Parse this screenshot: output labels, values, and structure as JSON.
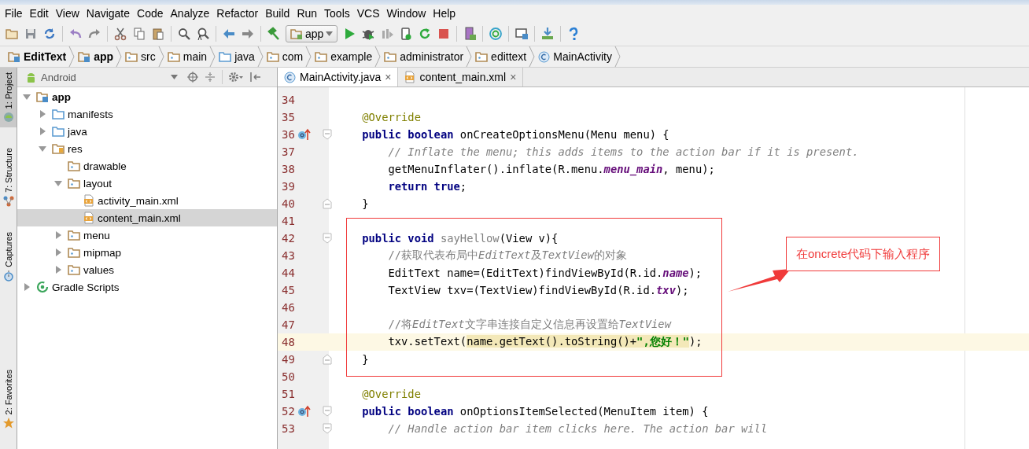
{
  "menu": [
    "File",
    "Edit",
    "View",
    "Navigate",
    "Code",
    "Analyze",
    "Refactor",
    "Build",
    "Run",
    "Tools",
    "VCS",
    "Window",
    "Help"
  ],
  "run_config": {
    "label": "app"
  },
  "breadcrumb": [
    {
      "label": "EditText",
      "kind": "module",
      "bold": true
    },
    {
      "label": "app",
      "kind": "module",
      "bold": true
    },
    {
      "label": "src",
      "kind": "folder",
      "bold": false
    },
    {
      "label": "main",
      "kind": "folder",
      "bold": false
    },
    {
      "label": "java",
      "kind": "source-folder",
      "bold": false
    },
    {
      "label": "com",
      "kind": "package",
      "bold": false
    },
    {
      "label": "example",
      "kind": "package",
      "bold": false
    },
    {
      "label": "administrator",
      "kind": "package",
      "bold": false
    },
    {
      "label": "edittext",
      "kind": "package",
      "bold": false
    },
    {
      "label": "MainActivity",
      "kind": "class",
      "bold": false
    }
  ],
  "side_tabs_top": [
    {
      "label": "1: Project",
      "selected": true,
      "kind": "android"
    },
    {
      "label": "7: Structure",
      "selected": false,
      "kind": "structure"
    },
    {
      "label": "Captures",
      "selected": false,
      "kind": "captures"
    }
  ],
  "side_tabs_bottom": [
    {
      "label": "2: Favorites",
      "selected": false,
      "kind": "star"
    }
  ],
  "project_view": {
    "label": "Android"
  },
  "tree": [
    {
      "label": "app",
      "kind": "module",
      "expanded": true,
      "selected": false,
      "bold": true,
      "children": [
        {
          "label": "manifests",
          "kind": "source-folder",
          "expanded": false,
          "selected": false,
          "bold": false
        },
        {
          "label": "java",
          "kind": "source-folder",
          "expanded": false,
          "selected": false,
          "bold": false
        },
        {
          "label": "res",
          "kind": "res-folder",
          "expanded": true,
          "selected": false,
          "bold": false,
          "children": [
            {
              "label": "drawable",
              "kind": "folder",
              "selected": false,
              "bold": false
            },
            {
              "label": "layout",
              "kind": "folder",
              "expanded": true,
              "selected": false,
              "bold": false,
              "children": [
                {
                  "label": "activity_main.xml",
                  "kind": "xml-file",
                  "selected": false,
                  "bold": false
                },
                {
                  "label": "content_main.xml",
                  "kind": "xml-file",
                  "selected": true,
                  "bold": false
                }
              ]
            },
            {
              "label": "menu",
              "kind": "folder",
              "expanded": false,
              "selected": false,
              "bold": false
            },
            {
              "label": "mipmap",
              "kind": "folder",
              "expanded": false,
              "selected": false,
              "bold": false
            },
            {
              "label": "values",
              "kind": "folder",
              "expanded": false,
              "selected": false,
              "bold": false
            }
          ]
        }
      ]
    },
    {
      "label": "Gradle Scripts",
      "kind": "gradle",
      "expanded": false,
      "selected": false,
      "bold": false
    }
  ],
  "editor_tabs": [
    {
      "label": "MainActivity.java",
      "kind": "class",
      "selected": true,
      "close": "×"
    },
    {
      "label": "content_main.xml",
      "kind": "xml-file",
      "selected": false,
      "close": "×"
    }
  ],
  "code_lines": [
    {
      "number": "34",
      "current": false,
      "override": false,
      "fold_start": false,
      "fold_end": false
    },
    {
      "number": "35",
      "current": false,
      "override": false,
      "fold_start": false,
      "fold_end": false,
      "tokens": [
        {
          "kind": "annotation",
          "text": "    @Override"
        }
      ]
    },
    {
      "number": "36",
      "current": false,
      "override": true,
      "fold_start": true,
      "fold_end": false,
      "tokens": [
        {
          "kind": "keyword",
          "text": "    public boolean "
        },
        {
          "kind": "plain",
          "text": "onCreateOptionsMenu(Menu menu) {"
        }
      ]
    },
    {
      "number": "37",
      "current": false,
      "override": false,
      "fold_start": false,
      "fold_end": false,
      "tokens": [
        {
          "kind": "comment",
          "text": "        // Inflate the menu; this adds items to the action bar if it is present."
        }
      ]
    },
    {
      "number": "38",
      "current": false,
      "override": false,
      "fold_start": false,
      "fold_end": false,
      "tokens": [
        {
          "kind": "plain",
          "text": "        getMenuInflater().inflate(R.menu."
        },
        {
          "kind": "field",
          "text": "menu_main"
        },
        {
          "kind": "plain",
          "text": ", menu);"
        }
      ]
    },
    {
      "number": "39",
      "current": false,
      "override": false,
      "fold_start": false,
      "fold_end": false,
      "tokens": [
        {
          "kind": "keyword",
          "text": "        return true"
        },
        {
          "kind": "plain",
          "text": ";"
        }
      ]
    },
    {
      "number": "40",
      "current": false,
      "override": false,
      "fold_start": false,
      "fold_end": true,
      "tokens": [
        {
          "kind": "plain",
          "text": "    }"
        }
      ]
    },
    {
      "number": "41",
      "current": false,
      "override": false,
      "fold_start": false,
      "fold_end": false
    },
    {
      "number": "42",
      "current": false,
      "override": false,
      "fold_start": true,
      "fold_end": false,
      "tokens": [
        {
          "kind": "keyword",
          "text": "    public void "
        },
        {
          "kind": "unused",
          "text": "sayHellow"
        },
        {
          "kind": "plain",
          "text": "(View v){"
        }
      ]
    },
    {
      "number": "43",
      "current": false,
      "override": false,
      "fold_start": false,
      "fold_end": false,
      "tokens": [
        {
          "kind": "comment-cjk",
          "text": "        //获取代表布局中"
        },
        {
          "kind": "comment",
          "text": "EditText"
        },
        {
          "kind": "comment-cjk",
          "text": "及"
        },
        {
          "kind": "comment",
          "text": "TextView"
        },
        {
          "kind": "comment-cjk",
          "text": "的对象"
        }
      ]
    },
    {
      "number": "44",
      "current": false,
      "override": false,
      "fold_start": false,
      "fold_end": false,
      "tokens": [
        {
          "kind": "plain",
          "text": "        EditText name=(EditText)findViewById(R.id."
        },
        {
          "kind": "field",
          "text": "name"
        },
        {
          "kind": "plain",
          "text": ");"
        }
      ]
    },
    {
      "number": "45",
      "current": false,
      "override": false,
      "fold_start": false,
      "fold_end": false,
      "tokens": [
        {
          "kind": "plain",
          "text": "        TextView txv=(TextView)findViewById(R.id."
        },
        {
          "kind": "field",
          "text": "txv"
        },
        {
          "kind": "plain",
          "text": ");"
        }
      ]
    },
    {
      "number": "46",
      "current": false,
      "override": false,
      "fold_start": false,
      "fold_end": false
    },
    {
      "number": "47",
      "current": false,
      "override": false,
      "fold_start": false,
      "fold_end": false,
      "tokens": [
        {
          "kind": "comment-cjk",
          "text": "        //将"
        },
        {
          "kind": "comment",
          "text": "EditText"
        },
        {
          "kind": "comment-cjk",
          "text": "文字串连接自定义信息再设置给"
        },
        {
          "kind": "comment",
          "text": "TextView"
        }
      ]
    },
    {
      "number": "48",
      "current": true,
      "override": false,
      "fold_start": false,
      "fold_end": false,
      "tokens": [
        {
          "kind": "plain",
          "text": "        txv.setText("
        },
        {
          "kind": "plain-highlighted",
          "text": "name.getText().toString()+"
        },
        {
          "kind": "string-highlighted",
          "text": "\",您好！\""
        },
        {
          "kind": "plain",
          "text": ");"
        }
      ]
    },
    {
      "number": "49",
      "current": false,
      "override": false,
      "fold_start": false,
      "fold_end": true,
      "tokens": [
        {
          "kind": "plain",
          "text": "    }"
        }
      ]
    },
    {
      "number": "50",
      "current": false,
      "override": false,
      "fold_start": false,
      "fold_end": false
    },
    {
      "number": "51",
      "current": false,
      "override": false,
      "fold_start": false,
      "fold_end": false,
      "tokens": [
        {
          "kind": "annotation",
          "text": "    @Override"
        }
      ]
    },
    {
      "number": "52",
      "current": false,
      "override": true,
      "fold_start": true,
      "fold_end": false,
      "tokens": [
        {
          "kind": "keyword",
          "text": "    public boolean "
        },
        {
          "kind": "plain",
          "text": "onOptionsItemSelected(MenuItem item) {"
        }
      ]
    },
    {
      "number": "53",
      "current": false,
      "override": false,
      "fold_start": true,
      "fold_end": false,
      "tokens": [
        {
          "kind": "comment",
          "text": "        // Handle action bar item clicks here. The action bar will"
        }
      ]
    }
  ],
  "callout": {
    "text": "在oncrete代码下输入程序"
  }
}
